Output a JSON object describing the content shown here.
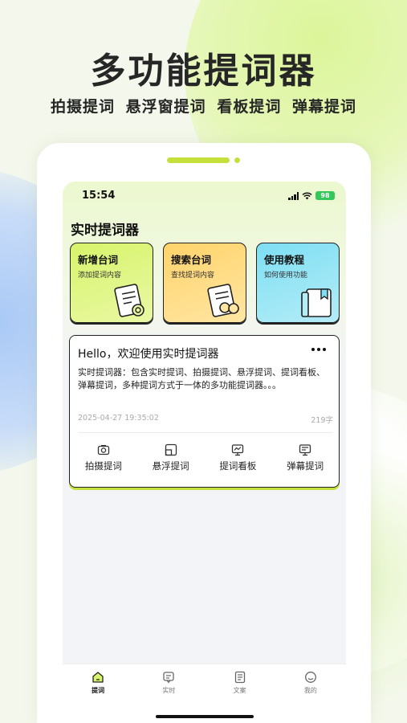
{
  "promo": {
    "headline": "多功能提词器",
    "features": [
      "拍摄提词",
      "悬浮窗提词",
      "看板提词",
      "弹幕提词"
    ]
  },
  "status_bar": {
    "time": "15:54",
    "battery": "98"
  },
  "app": {
    "title": "实时提词器"
  },
  "cards": [
    {
      "title": "新增台词",
      "desc": "添加提词内容",
      "icon": "script-edit-icon",
      "color": "#d7f46a"
    },
    {
      "title": "搜索台词",
      "desc": "查找提词内容",
      "icon": "script-search-icon",
      "color": "#ffd36a"
    },
    {
      "title": "使用教程",
      "desc": "如何使用功能",
      "icon": "tutorial-book-icon",
      "color": "#7ddff3"
    }
  ],
  "info_card": {
    "title": "Hello，欢迎使用实时提词器",
    "body": "实时提词器：包含实时提词、拍摄提词、悬浮提词、提词看板、弹幕提词，多种提词方式于一体的多功能提词器。。。",
    "timestamp": "2025-04-27 19:35:02",
    "char_count": "219字",
    "actions": [
      {
        "label": "拍摄提词",
        "icon": "camera-icon"
      },
      {
        "label": "悬浮提词",
        "icon": "float-window-icon"
      },
      {
        "label": "提词看板",
        "icon": "board-icon"
      },
      {
        "label": "弹幕提词",
        "icon": "barrage-icon"
      }
    ]
  },
  "tabbar": [
    {
      "label": "提词",
      "icon": "home-icon",
      "active": true
    },
    {
      "label": "实时",
      "icon": "message-icon",
      "active": false
    },
    {
      "label": "文案",
      "icon": "document-icon",
      "active": false
    },
    {
      "label": "我的",
      "icon": "profile-icon",
      "active": false
    }
  ],
  "colors": {
    "accent": "#c4e03a",
    "text": "#262626"
  }
}
